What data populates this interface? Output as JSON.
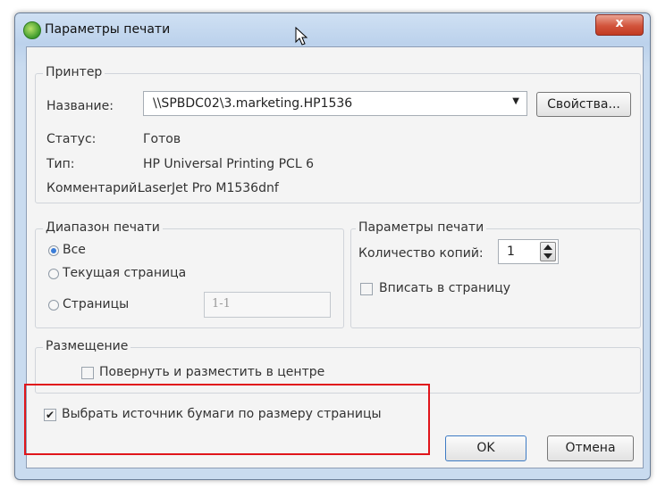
{
  "window": {
    "title": "Параметры печати",
    "close_glyph": "x"
  },
  "printer": {
    "legend": "Принтер",
    "name_label": "Название:",
    "name_value": "\\\\SPBDC02\\3.marketing.HP1536",
    "properties_button": "Свойства...",
    "status_label": "Статус:",
    "status_value": "Готов",
    "type_label": "Тип:",
    "type_value": "HP Universal Printing PCL 6",
    "comment_label": "Комментарий:",
    "comment_value": "LaserJet Pro M1536dnf"
  },
  "range": {
    "legend": "Диапазон печати",
    "all": "Все",
    "current": "Текущая страница",
    "pages": "Страницы",
    "pages_value": "1-1"
  },
  "print_params": {
    "legend": "Параметры печати",
    "copies_label": "Количество копий:",
    "copies_value": "1",
    "fit_label": "Вписать в страницу"
  },
  "placement": {
    "legend": "Размещение",
    "rotate_center": "Повернуть и разместить в центре"
  },
  "paper_source_label": "Выбрать источник бумаги по размеру страницы",
  "buttons": {
    "ok": "OK",
    "cancel": "Отмена"
  },
  "colors": {
    "highlight": "#e0151b",
    "accent": "#3b7dd8"
  }
}
